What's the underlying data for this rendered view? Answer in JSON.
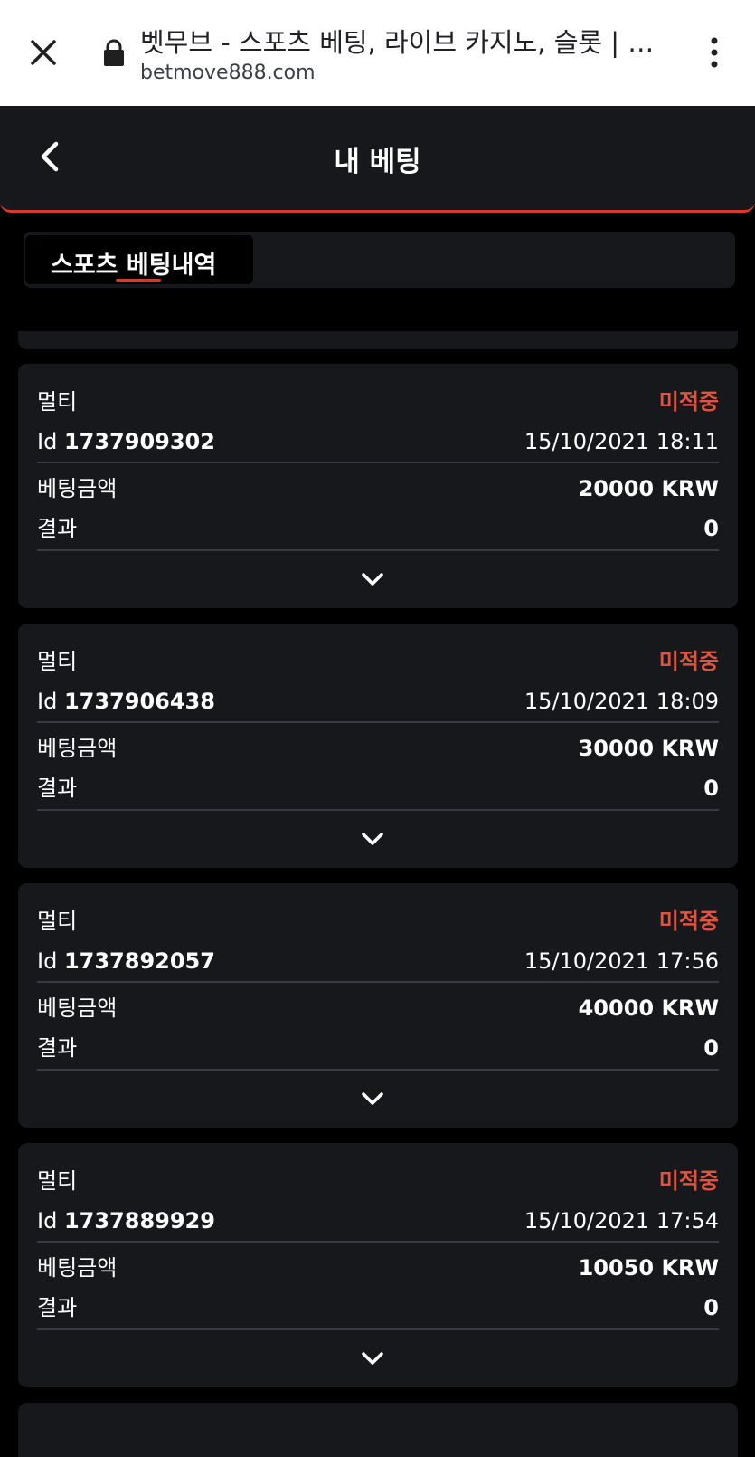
{
  "browser": {
    "title": "벳무브 - 스포츠 베팅, 라이브 카지노, 슬롯 | …",
    "url": "betmove888.com"
  },
  "header": {
    "title": "내 베팅"
  },
  "tabs": [
    {
      "label": "스포츠 베팅내역",
      "active": true
    }
  ],
  "labels": {
    "id_prefix": "Id",
    "bet_amount": "베팅금액",
    "result": "결과"
  },
  "bets": [
    {
      "type": "멀티",
      "status": "미적중",
      "id": "1737909302",
      "datetime": "15/10/2021 18:11",
      "amount": "20000 KRW",
      "result": "0"
    },
    {
      "type": "멀티",
      "status": "미적중",
      "id": "1737906438",
      "datetime": "15/10/2021 18:09",
      "amount": "30000 KRW",
      "result": "0"
    },
    {
      "type": "멀티",
      "status": "미적중",
      "id": "1737892057",
      "datetime": "15/10/2021 17:56",
      "amount": "40000 KRW",
      "result": "0"
    },
    {
      "type": "멀티",
      "status": "미적중",
      "id": "1737889929",
      "datetime": "15/10/2021 17:54",
      "amount": "10050 KRW",
      "result": "0"
    }
  ],
  "colors": {
    "accent": "#d9382f",
    "status_lost": "#e0533f",
    "card_bg": "#17181c",
    "page_bg": "#000000"
  },
  "icons": {
    "close": "close-icon",
    "lock": "lock-icon",
    "menu": "more-vert-icon",
    "back": "chevron-left-icon",
    "expand": "chevron-down-icon"
  }
}
